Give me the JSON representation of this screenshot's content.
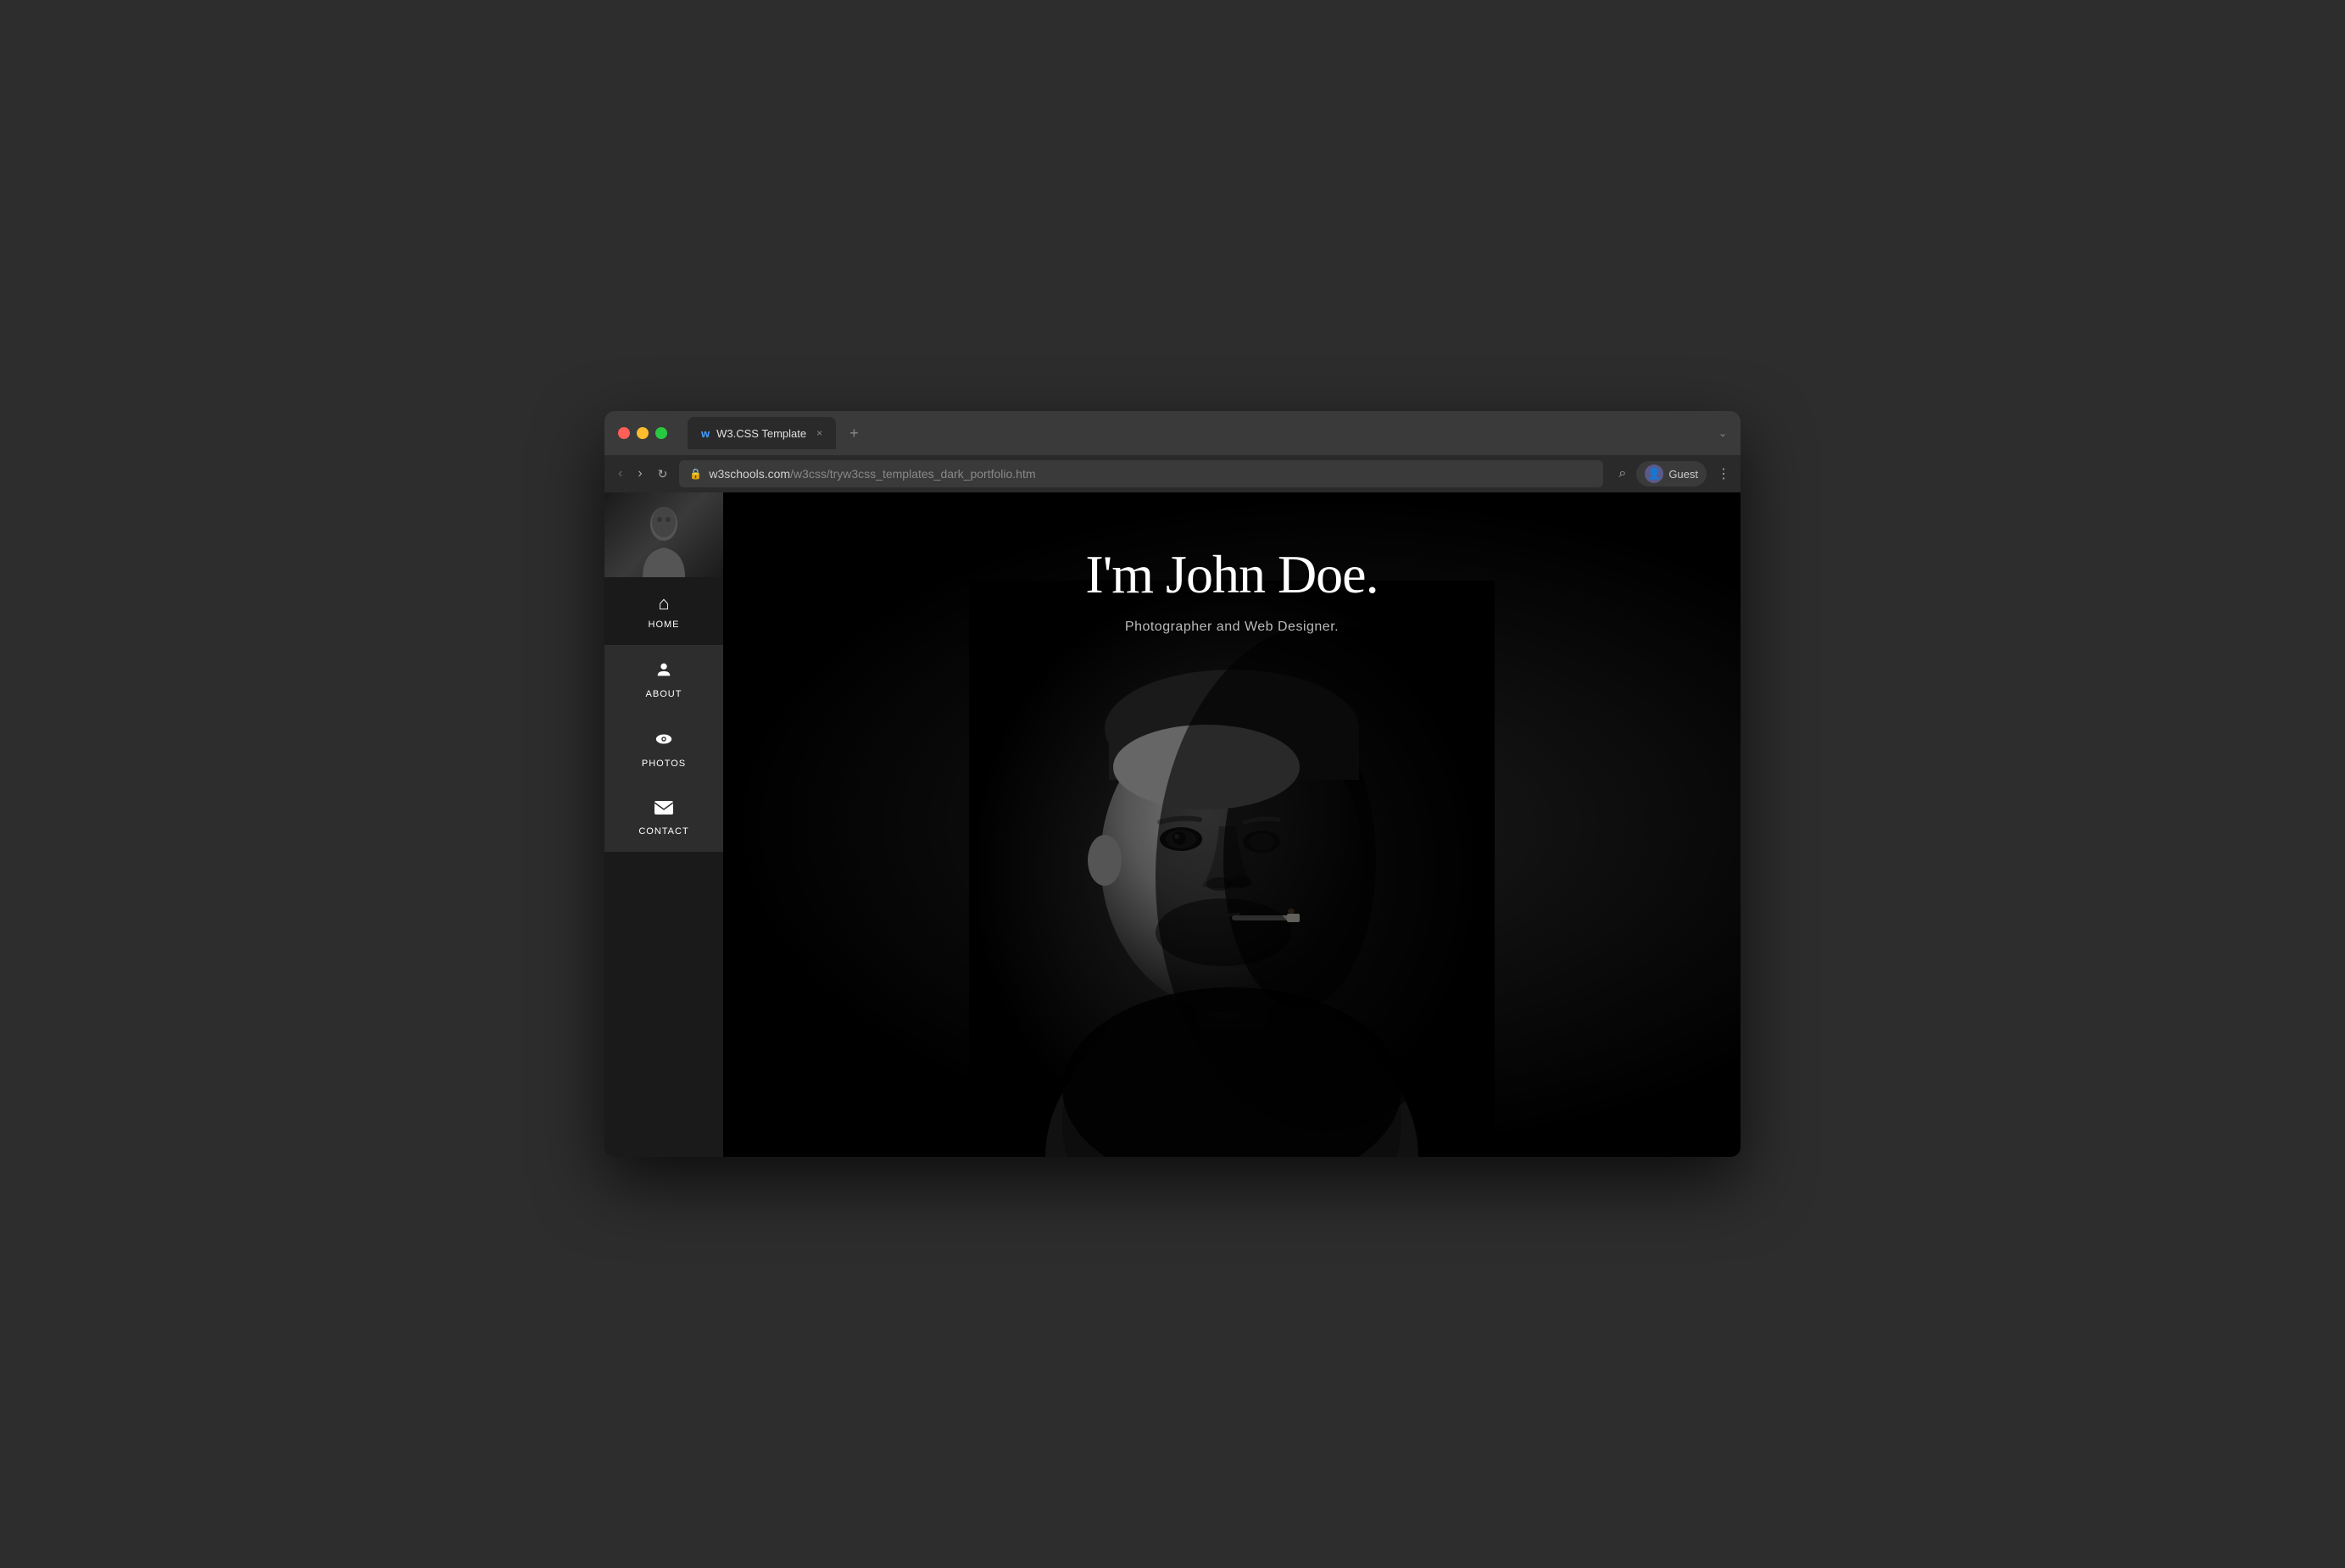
{
  "browser": {
    "tab_favicon": "w",
    "tab_title": "W3.CSS Template",
    "tab_close": "×",
    "tab_new": "+",
    "tab_dropdown": "⌄",
    "nav_back": "‹",
    "nav_forward": "›",
    "nav_refresh": "↻",
    "url_lock": "🔒",
    "url_domain": "w3schools.com",
    "url_path": "/w3css/tryw3css_templates_dark_portfolio.htm",
    "search_icon": "⌕",
    "user_icon": "👤",
    "user_label": "Guest",
    "menu_icon": "⋮"
  },
  "sidebar": {
    "nav_items": [
      {
        "id": "home",
        "label": "HOME",
        "icon": "⌂",
        "active": true
      },
      {
        "id": "about",
        "label": "ABOUT",
        "icon": "👤"
      },
      {
        "id": "photos",
        "label": "PHOTOS",
        "icon": "👁"
      },
      {
        "id": "contact",
        "label": "CONTACT",
        "icon": "✉"
      }
    ]
  },
  "hero": {
    "title": "I'm John Doe.",
    "subtitle": "Photographer and Web Designer."
  }
}
